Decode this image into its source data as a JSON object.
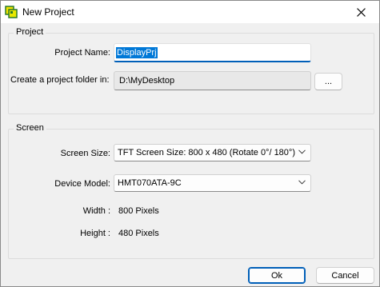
{
  "window": {
    "title": "New Project"
  },
  "project": {
    "group_title": "Project",
    "name_label": "Project Name:",
    "name_value": "DisplayPrj",
    "folder_label": "Create a project folder in:",
    "folder_value": "D:\\MyDesktop",
    "browse_label": "..."
  },
  "screen": {
    "group_title": "Screen",
    "size_label": "Screen Size:",
    "size_value": "TFT Screen Size: 800 x 480 (Rotate 0°/ 180°)",
    "model_label": "Device Model:",
    "model_value": "HMT070ATA-9C",
    "width_label": "Width :",
    "width_value": "800 Pixels",
    "height_label": "Height :",
    "height_value": "480 Pixels"
  },
  "buttons": {
    "ok": "Ok",
    "cancel": "Cancel"
  },
  "colors": {
    "accent": "#005fb8",
    "selection": "#0078d7"
  },
  "icons": {
    "app": "app-icon",
    "close": "close-icon",
    "dropdown": "chevron-down-icon"
  }
}
